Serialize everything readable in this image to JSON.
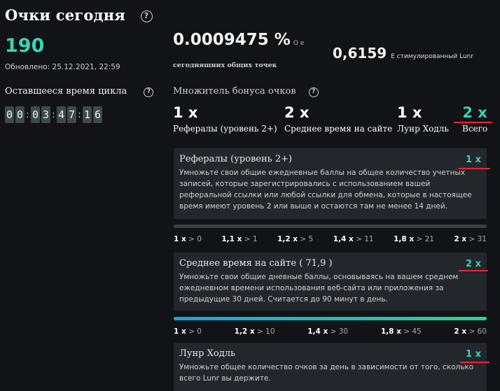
{
  "header": {
    "title": "Очки сегодня",
    "help": "?",
    "points": "190",
    "updated": "Обновлено: 25.12.2021, 22:59",
    "percent_value": "0.0009475 %",
    "percent_suffix": "О е",
    "percent_label": "сегодняшних общих точек",
    "lunr_value": "0,6159",
    "lunr_label": "Е стимулированный Lunr"
  },
  "cycle": {
    "label": "Оставшееся время цикла",
    "digits": [
      "0",
      "0",
      "0",
      "3",
      "4",
      "7",
      "1",
      "6"
    ],
    "separator": ":"
  },
  "multipliers": {
    "label": "Множитель бонуса очков",
    "items": [
      {
        "value": "1 x",
        "label": "Рефералы (уровень 2+)"
      },
      {
        "value": "2 x",
        "label": "Среднее время на сайте"
      },
      {
        "value": "1 x",
        "label": "Лунр Ходль"
      },
      {
        "value": "2 x",
        "label": "Всего"
      }
    ]
  },
  "cards": [
    {
      "title": "Рефералы (уровень 2+)",
      "mult": "1 x",
      "text": "Умножьте свои общие ежедневные баллы на общее количество учетных записей, которые зарегистрировались с использованием вашей реферальной ссылки или любой ссылки для обмена, которые в настоящее время имеют уровень 2 или выше и остаются там не менее 14 дней.",
      "progress": 0,
      "ticks": [
        {
          "m": "1 x",
          "c": "> 0"
        },
        {
          "m": "1,1 x",
          "c": "> 1"
        },
        {
          "m": "1,2 x",
          "c": "> 5"
        },
        {
          "m": "1,4 x",
          "c": "> 11"
        },
        {
          "m": "1,8 x",
          "c": "> 21"
        },
        {
          "m": "2 x",
          "c": "> 31"
        }
      ]
    },
    {
      "title": "Среднее время на сайте ( 71,9 )",
      "mult": "2 x",
      "text": "Умножьте свои общие дневные баллы, основываясь на вашем среднем ежедневном времени использования веб-сайта или приложения за предыдущие 30 дней. Считается до 90 минут в день.",
      "progress": 1,
      "ticks": [
        {
          "m": "1 x",
          "c": "> 0"
        },
        {
          "m": "1,2 x",
          "c": "> 10"
        },
        {
          "m": "1,4 x",
          "c": "> 30"
        },
        {
          "m": "1,8 x",
          "c": "> 45"
        },
        {
          "m": "2 x",
          "c": "> 60"
        }
      ]
    },
    {
      "title": "Лунр Ходль",
      "mult": "1 x",
      "text": "Умножьте общее количество очков за день в зависимости от того, сколько всего Lunr вы держите."
    }
  ],
  "colors": {
    "accent": "#39d3b3",
    "annotation": "#e8253a",
    "card": "#23272b",
    "background": "#111316"
  }
}
